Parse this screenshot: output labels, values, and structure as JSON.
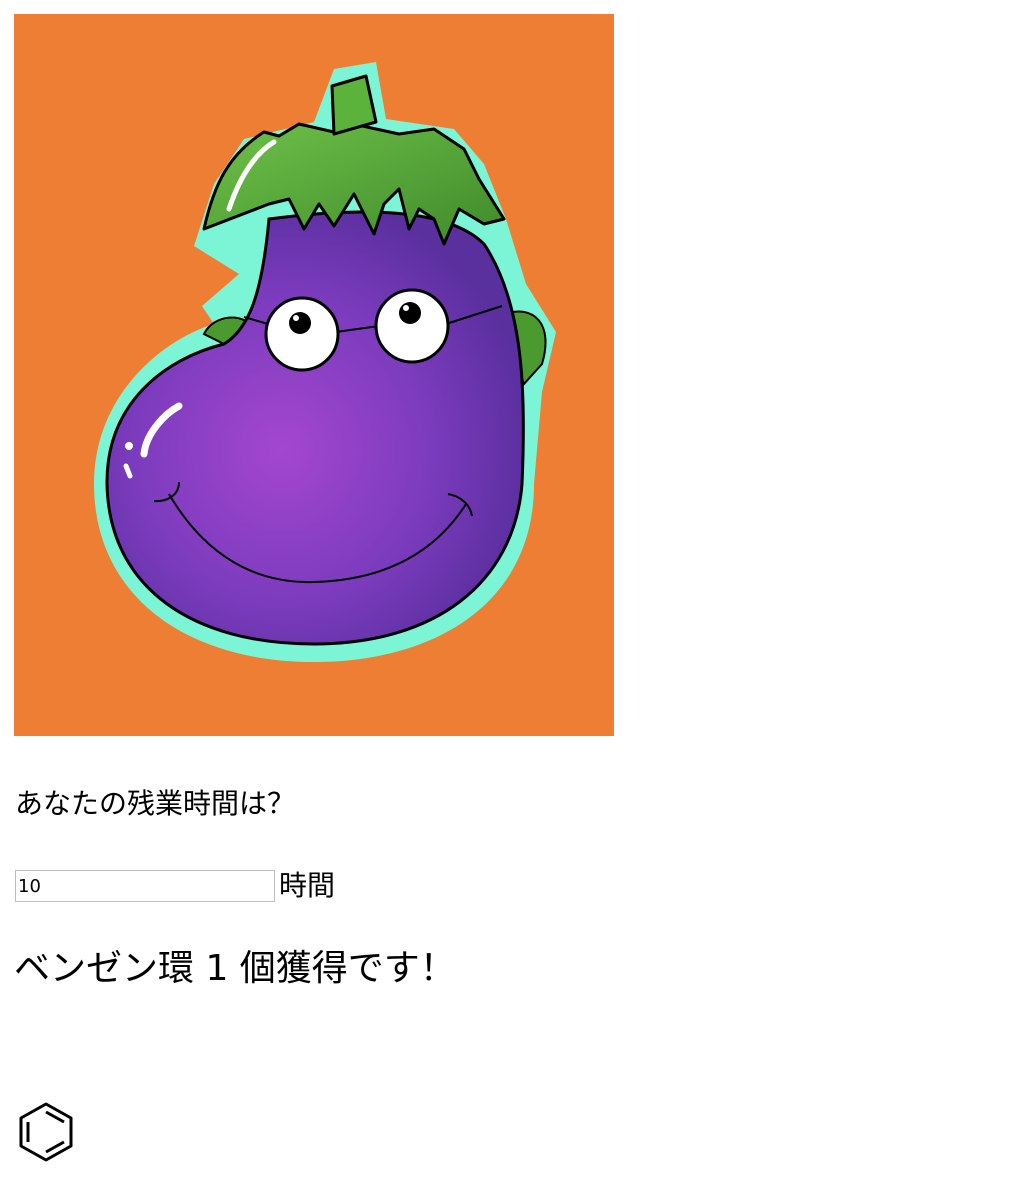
{
  "hero": {
    "image": "eggplant-character-illustration",
    "colors": {
      "background": "#ee7e33",
      "outline": "#7cf5d6",
      "body": "#8a3fc6",
      "leaf": "#5cb33b"
    }
  },
  "form": {
    "question": "あなたの残業時間は？",
    "hours_value": "10",
    "unit_label": "時間"
  },
  "result": {
    "text": "ベンゼン環 1 個獲得です！",
    "ring_count": 1,
    "ring_icon": "benzene-ring-icon"
  }
}
